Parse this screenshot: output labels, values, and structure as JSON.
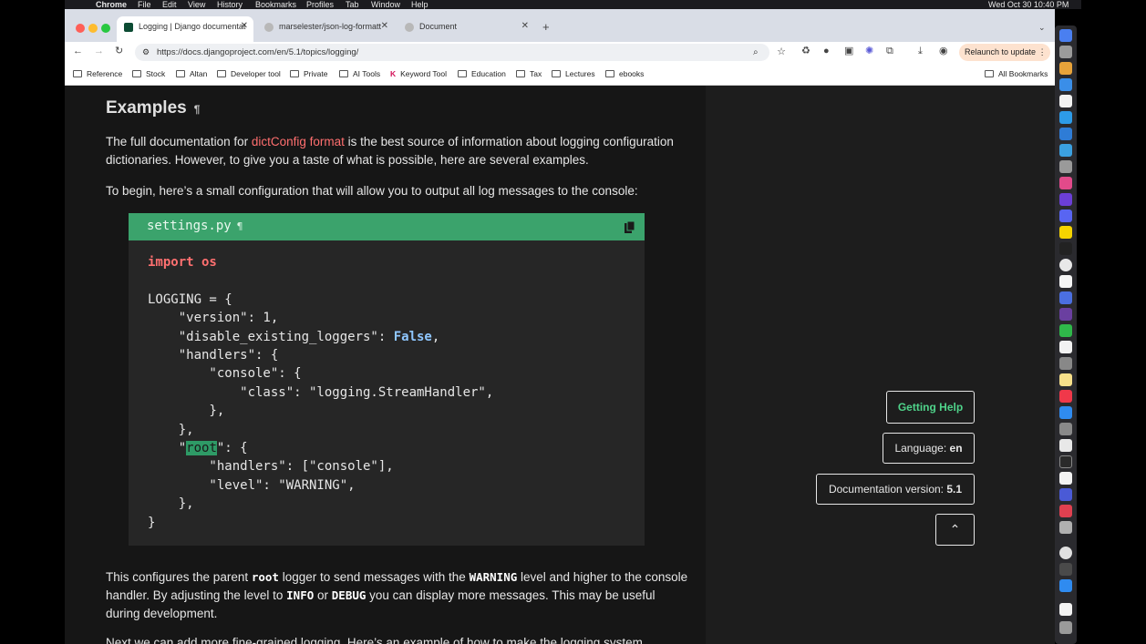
{
  "menubar": {
    "app": "Chrome",
    "menus": [
      "File",
      "Edit",
      "View",
      "History",
      "Bookmarks",
      "Profiles",
      "Tab",
      "Window",
      "Help"
    ],
    "clock": "Wed Oct 30  10:40 PM"
  },
  "tabs": [
    {
      "label": "Logging | Django documentat",
      "active": true
    },
    {
      "label": "marselester/json-log-formatt",
      "active": false
    },
    {
      "label": "Document",
      "active": false
    }
  ],
  "address_bar": {
    "url": "https://docs.djangoproject.com/en/5.1/topics/logging/"
  },
  "relaunch_label": "Relaunch to update",
  "bookmarks": [
    "Reference",
    "Stock",
    "Altan",
    "Developer tool",
    "Private",
    "AI Tools",
    "Keyword Tool",
    "Education",
    "Tax",
    "Lectures",
    "ebooks"
  ],
  "all_bookmarks": "All Bookmarks",
  "doc": {
    "heading": "Examples",
    "pilcrow": "¶",
    "p1_before": "The full documentation for ",
    "p1_link": "dictConfig format",
    "p1_after": " is the best source of information about logging configuration dictionaries. However, to give you a taste of what is possible, here are several examples.",
    "p2": "To begin, here’s a small configuration that will allow you to output all log messages to the console:",
    "code_filename": "settings.py",
    "p3_a": "This configures the parent ",
    "p3_root": "root",
    "p3_b": " logger to send messages with the ",
    "p3_warning": "WARNING",
    "p3_c": " level and higher to the console handler. By adjusting the level to ",
    "p3_info": "INFO",
    "p3_d": " or ",
    "p3_debug": "DEBUG",
    "p3_e": " you can display more messages. This may be useful during development.",
    "p4": "Next we can add more fine-grained logging. Here’s an example of how to make the logging system"
  },
  "code_lines": {
    "l1_kw": "import",
    "l1_mod": " os",
    "l3": "LOGGING = {",
    "l4": "    \"version\": 1,",
    "l5_a": "    \"disable_existing_loggers\": ",
    "l5_b": "False",
    "l5_c": ",",
    "l6": "    \"handlers\": {",
    "l7": "        \"console\": {",
    "l8": "            \"class\": \"logging.StreamHandler\",",
    "l9": "        },",
    "l10": "    },",
    "l11_a": "    \"",
    "l11_hl": "root",
    "l11_b": "\": {",
    "l12": "        \"handlers\": [\"console\"],",
    "l13": "        \"level\": \"WARNING\",",
    "l14": "    },",
    "l15": "}"
  },
  "sidebar": {
    "getting_help": "Getting Help",
    "language_label": "Language: ",
    "language_value": "en",
    "version_label": "Documentation version: ",
    "version_value": "5.1",
    "back_to_top": "⌃"
  }
}
